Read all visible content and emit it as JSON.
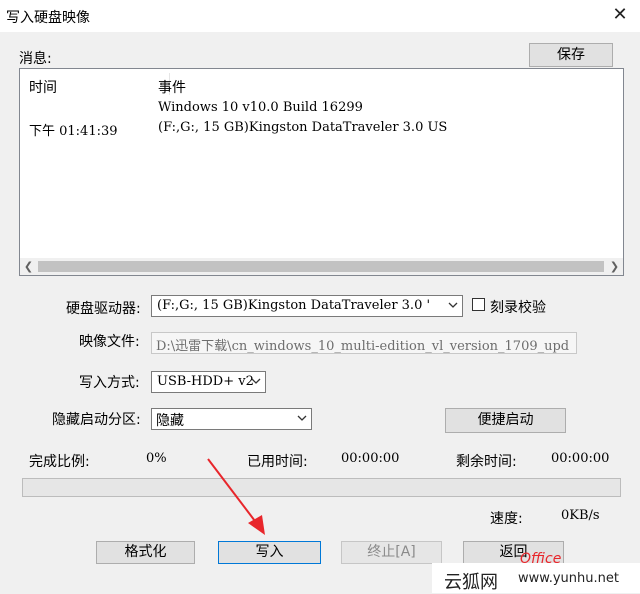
{
  "window": {
    "title": "写入硬盘映像",
    "close_glyph": "✕"
  },
  "messages": {
    "label": "消息:",
    "save_label": "保存",
    "columns": [
      "时间",
      "事件"
    ],
    "rows": [
      {
        "time": "",
        "event": "Windows 10 v10.0 Build 16299"
      },
      {
        "time": "下午 01:41:39",
        "event": "(F:,G:, 15 GB)Kingston DataTraveler 3.0 US"
      }
    ]
  },
  "drive": {
    "label": "硬盘驱动器:",
    "value": "(F:,G:, 15 GB)Kingston DataTraveler 3.0 '",
    "verify_label": "刻录校验",
    "verify_checked": false
  },
  "image_file": {
    "label": "映像文件:",
    "value": "D:\\迅雷下载\\cn_windows_10_multi-edition_vl_version_1709_upd"
  },
  "write_mode": {
    "label": "写入方式:",
    "value": "USB-HDD+ v2"
  },
  "hidden_partition": {
    "label": "隐藏启动分区:",
    "value": "隐藏",
    "quick_boot_label": "便捷启动"
  },
  "status": {
    "progress_label": "完成比例:",
    "progress_value": "0%",
    "progress_fraction": 0,
    "elapsed_label": "已用时间:",
    "elapsed_value": "00:00:00",
    "remaining_label": "剩余时间:",
    "remaining_value": "00:00:00",
    "speed_label": "速度:",
    "speed_value": "0KB/s"
  },
  "buttons": {
    "format": "格式化",
    "write": "写入",
    "abort": "终止[A]",
    "back": "返回"
  },
  "watermark": {
    "text1": "云狐网",
    "text2": "www.yunhu.net",
    "text3": "Office",
    "color": "#e8262b"
  }
}
